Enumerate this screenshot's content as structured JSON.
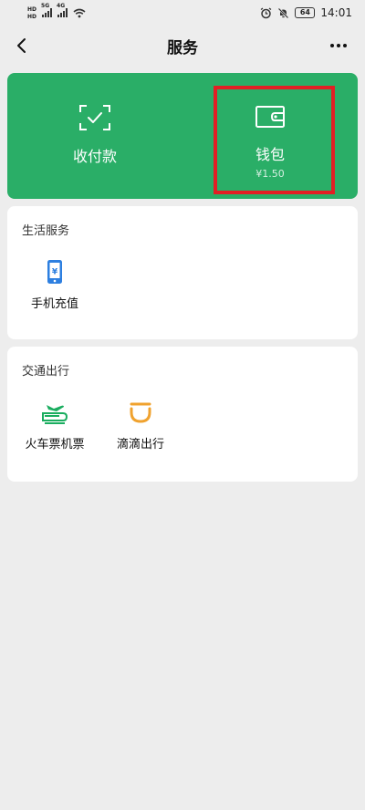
{
  "statusbar": {
    "hd_top": "HD",
    "hd_bottom": "HD",
    "net1": "5G",
    "net2": "4G",
    "battery": "64",
    "time": "14:01"
  },
  "navbar": {
    "title": "服务"
  },
  "wallet_card": {
    "pay": {
      "label": "收付款"
    },
    "wallet": {
      "label": "钱包",
      "balance": "¥1.50"
    }
  },
  "sections": [
    {
      "title": "生活服务",
      "items": [
        {
          "label": "手机充值",
          "icon": "phone-recharge-icon"
        }
      ]
    },
    {
      "title": "交通出行",
      "items": [
        {
          "label": "火车票机票",
          "icon": "train-plane-icon"
        },
        {
          "label": "滴滴出行",
          "icon": "didi-icon"
        }
      ]
    }
  ],
  "colors": {
    "accent_green": "#2aae67",
    "background": "#ededed",
    "highlight_red": "#e21f24",
    "didi_orange": "#f0a22e",
    "phone_blue": "#2d7fe0"
  }
}
